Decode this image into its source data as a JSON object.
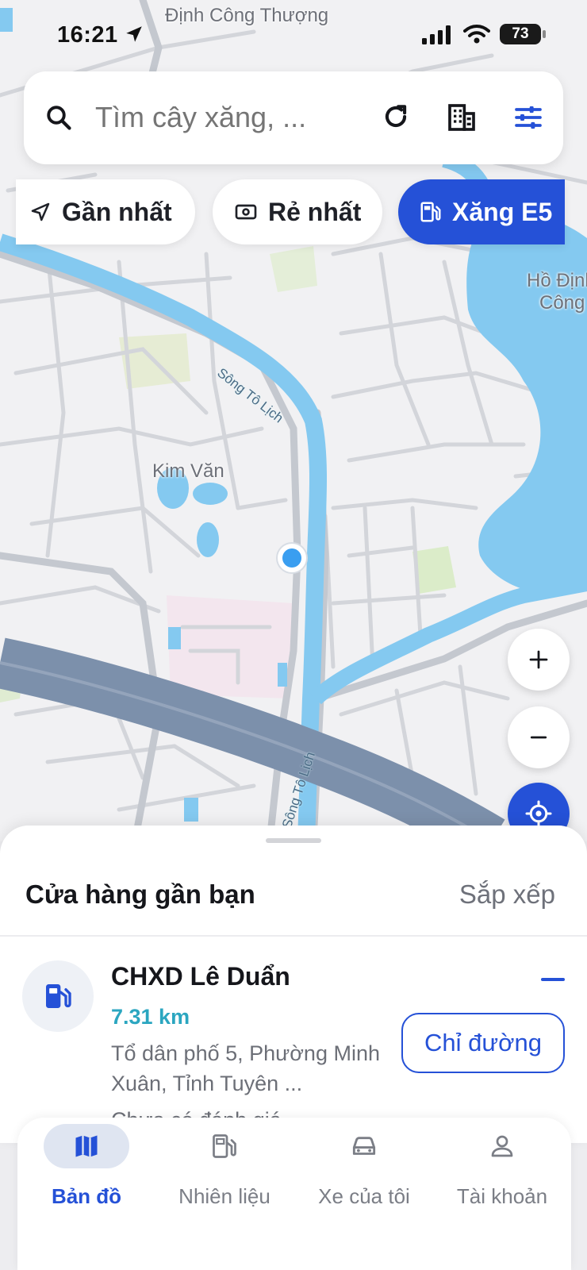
{
  "status_bar": {
    "time": "16:21",
    "battery": "73"
  },
  "map": {
    "labels": {
      "dinh_cong_thuong": "Định Công Thượng",
      "kim_van": "Kim Văn",
      "lake_line1": "Hồ Định",
      "lake_line2": "Công",
      "river_1": "Sông Tô Lịch",
      "river_2": "Sông Tô Lịch"
    },
    "zoom_in": "+",
    "zoom_out": "−"
  },
  "search": {
    "placeholder": "Tìm cây xăng, ..."
  },
  "chips": [
    {
      "label": "Gần nhất",
      "icon": "navigation-arrow-icon",
      "active": false
    },
    {
      "label": "Rẻ nhất",
      "icon": "cash-icon",
      "active": false
    },
    {
      "label": "Xăng E5",
      "icon": "fuel-pump-icon",
      "active": true
    }
  ],
  "sheet": {
    "title": "Cửa hàng gần bạn",
    "sort": "Sắp xếp",
    "station": {
      "name": "CHXD Lê Duẩn",
      "distance": "7.31 km",
      "address": "Tổ dân phố 5, Phường Minh Xuân, Tỉnh Tuyên ...",
      "status_partial": "Chưa có đánh giá",
      "directions": "Chỉ đường"
    }
  },
  "tabs": [
    {
      "label": "Bản đồ",
      "icon": "map-icon",
      "active": true
    },
    {
      "label": "Nhiên liệu",
      "icon": "fuel-pump-icon",
      "active": false
    },
    {
      "label": "Xe của tôi",
      "icon": "car-icon",
      "active": false
    },
    {
      "label": "Tài khoản",
      "icon": "person-icon",
      "active": false
    }
  ],
  "colors": {
    "accent": "#2551d7",
    "distance": "#2ba6c0",
    "water": "#84c9f0",
    "highway": "#7c90ab"
  }
}
